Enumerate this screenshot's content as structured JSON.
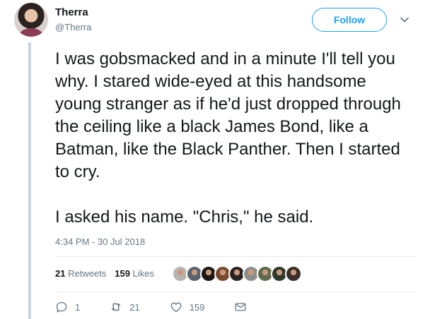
{
  "user": {
    "name": "Therra",
    "handle": "@Therra"
  },
  "follow_label": "Follow",
  "tweet": {
    "paragraphs": [
      "I was gobsmacked and in a minute I'll tell you why. I stared wide-eyed at this handsome young stranger as if he'd just dropped through the ceiling like a black James Bond, like a Batman, like the Black Panther. Then I started to cry.",
      "I asked his name. \"Chris,\" he said."
    ],
    "timestamp": "4:34 PM - 30 Jul 2018"
  },
  "stats": {
    "retweets_count": "21",
    "retweets_label": "Retweets",
    "likes_count": "159",
    "likes_label": "Likes"
  },
  "liker_faces": [
    "#b9b4ae",
    "#5a6470",
    "#1c1714",
    "#7a4a30",
    "#2a2420",
    "#8d8f8a",
    "#5e6a4a",
    "#2f3a2a",
    "#3a2e2a"
  ],
  "actions": {
    "replies": "1",
    "retweets": "21",
    "likes": "159"
  },
  "colors": {
    "accent": "#1da1f2",
    "muted": "#657786",
    "text": "#14171a"
  }
}
